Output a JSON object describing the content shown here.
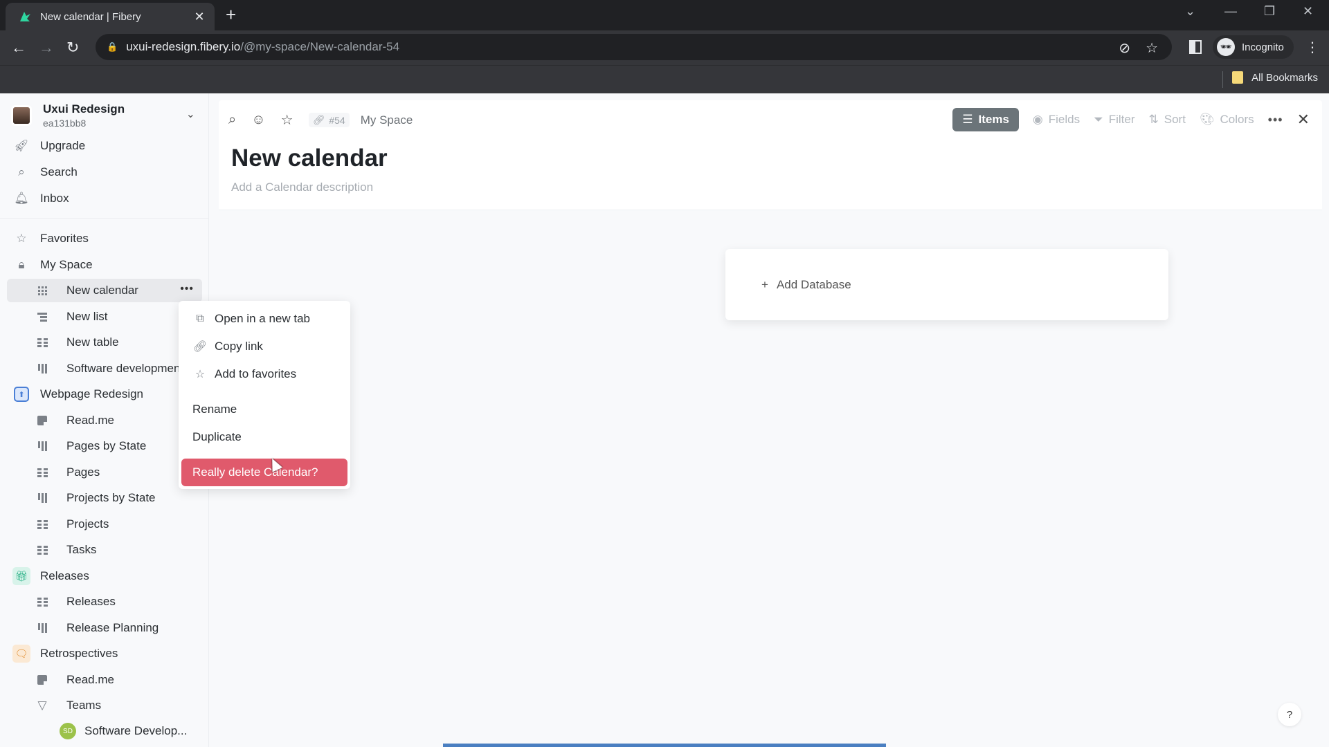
{
  "browser": {
    "tab_title": "New calendar | Fibery",
    "url_host": "uxui-redesign.fibery.io",
    "url_path": "/@my-space/New-calendar-54",
    "profile_label": "Incognito",
    "bookmarks_label": "All Bookmarks"
  },
  "workspace": {
    "name": "Uxui Redesign",
    "id": "ea131bb8"
  },
  "sidebar": {
    "top_items": [
      {
        "label": "Upgrade",
        "icon": "rocket-icon"
      },
      {
        "label": "Search",
        "icon": "search-icon"
      },
      {
        "label": "Inbox",
        "icon": "bell-icon"
      }
    ],
    "favorites_label": "Favorites",
    "my_space_label": "My Space",
    "my_space_items": [
      {
        "label": "New calendar",
        "icon": "calendar-view-icon",
        "selected": true
      },
      {
        "label": "New list",
        "icon": "list-view-icon"
      },
      {
        "label": "New table",
        "icon": "table-view-icon"
      },
      {
        "label": "Software developmen",
        "icon": "board-view-icon"
      }
    ],
    "spaces": [
      {
        "label": "Webpage Redesign",
        "icon": "upload-box-icon",
        "color": "#4a7fd6",
        "items": [
          {
            "label": "Read.me",
            "icon": "document-icon"
          },
          {
            "label": "Pages by State",
            "icon": "board-view-icon"
          },
          {
            "label": "Pages",
            "icon": "table-view-icon"
          },
          {
            "label": "Projects by State",
            "icon": "board-view-icon"
          },
          {
            "label": "Projects",
            "icon": "table-view-icon"
          },
          {
            "label": "Tasks",
            "icon": "table-view-icon"
          }
        ]
      },
      {
        "label": "Releases",
        "icon": "gift-icon",
        "color": "#2fb38a",
        "items": [
          {
            "label": "Releases",
            "icon": "table-view-icon"
          },
          {
            "label": "Release Planning",
            "icon": "board-view-icon"
          }
        ]
      },
      {
        "label": "Retrospectives",
        "icon": "chat-bubbles-icon",
        "color": "#e08a2a",
        "items": [
          {
            "label": "Read.me",
            "icon": "document-icon"
          },
          {
            "label": "Teams",
            "icon": "triangle-down-icon"
          }
        ]
      }
    ],
    "team_item": {
      "label": "Software Develop...",
      "initials": "SD",
      "color": "#9cc24a"
    }
  },
  "main": {
    "entity_id": "#54",
    "breadcrumb": "My Space",
    "title": "New calendar",
    "description_placeholder": "Add a Calendar description",
    "view_toolbar": {
      "items": "Items",
      "fields": "Fields",
      "filter": "Filter",
      "sort": "Sort",
      "colors": "Colors"
    },
    "add_database": "Add Database",
    "help": "?"
  },
  "context_menu": {
    "items": [
      {
        "label": "Open in a new tab",
        "icon": "external-link-icon"
      },
      {
        "label": "Copy link",
        "icon": "link-icon"
      },
      {
        "label": "Add to favorites",
        "icon": "star-icon"
      }
    ],
    "rename": "Rename",
    "duplicate": "Duplicate",
    "delete_confirm": "Really delete Calendar?"
  },
  "colors": {
    "danger": "#e05a6c",
    "items_button": "#6b7479",
    "progress": "#4a7fc1"
  }
}
